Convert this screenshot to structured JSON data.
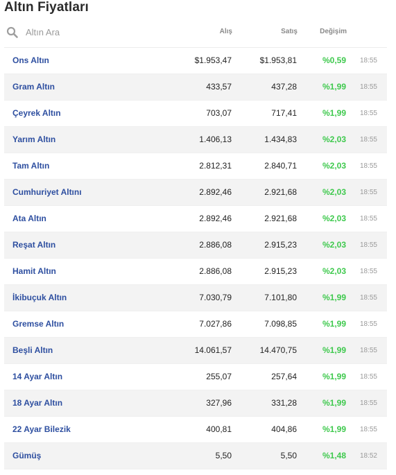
{
  "page": {
    "title": "Altın Fiyatları"
  },
  "search": {
    "placeholder": "Altın Ara",
    "icon": "search-icon"
  },
  "columns": {
    "bid": "Alış",
    "ask": "Satış",
    "change": "Değişim"
  },
  "colors": {
    "name_link": "#2e4fa0",
    "change_positive": "#3ec94d",
    "time": "#9a9a9a",
    "row_alt_bg": "#f3f3f3"
  },
  "rows": [
    {
      "name": "Ons Altın",
      "bid": "$1.953,47",
      "ask": "$1.953,81",
      "change": "%0,59",
      "time": "18:55"
    },
    {
      "name": "Gram Altın",
      "bid": "433,57",
      "ask": "437,28",
      "change": "%1,99",
      "time": "18:55"
    },
    {
      "name": "Çeyrek Altın",
      "bid": "703,07",
      "ask": "717,41",
      "change": "%1,99",
      "time": "18:55"
    },
    {
      "name": "Yarım Altın",
      "bid": "1.406,13",
      "ask": "1.434,83",
      "change": "%2,03",
      "time": "18:55"
    },
    {
      "name": "Tam Altın",
      "bid": "2.812,31",
      "ask": "2.840,71",
      "change": "%2,03",
      "time": "18:55"
    },
    {
      "name": "Cumhuriyet Altını",
      "bid": "2.892,46",
      "ask": "2.921,68",
      "change": "%2,03",
      "time": "18:55"
    },
    {
      "name": "Ata Altın",
      "bid": "2.892,46",
      "ask": "2.921,68",
      "change": "%2,03",
      "time": "18:55"
    },
    {
      "name": "Reşat Altın",
      "bid": "2.886,08",
      "ask": "2.915,23",
      "change": "%2,03",
      "time": "18:55"
    },
    {
      "name": "Hamit Altın",
      "bid": "2.886,08",
      "ask": "2.915,23",
      "change": "%2,03",
      "time": "18:55"
    },
    {
      "name": "İkibuçuk Altın",
      "bid": "7.030,79",
      "ask": "7.101,80",
      "change": "%1,99",
      "time": "18:55"
    },
    {
      "name": "Gremse Altın",
      "bid": "7.027,86",
      "ask": "7.098,85",
      "change": "%1,99",
      "time": "18:55"
    },
    {
      "name": "Beşli Altın",
      "bid": "14.061,57",
      "ask": "14.470,75",
      "change": "%1,99",
      "time": "18:55"
    },
    {
      "name": "14 Ayar Altın",
      "bid": "255,07",
      "ask": "257,64",
      "change": "%1,99",
      "time": "18:55"
    },
    {
      "name": "18 Ayar Altın",
      "bid": "327,96",
      "ask": "331,28",
      "change": "%1,99",
      "time": "18:55"
    },
    {
      "name": "22 Ayar Bilezik",
      "bid": "400,81",
      "ask": "404,86",
      "change": "%1,99",
      "time": "18:55"
    },
    {
      "name": "Gümüş",
      "bid": "5,50",
      "ask": "5,50",
      "change": "%1,48",
      "time": "18:52"
    }
  ]
}
